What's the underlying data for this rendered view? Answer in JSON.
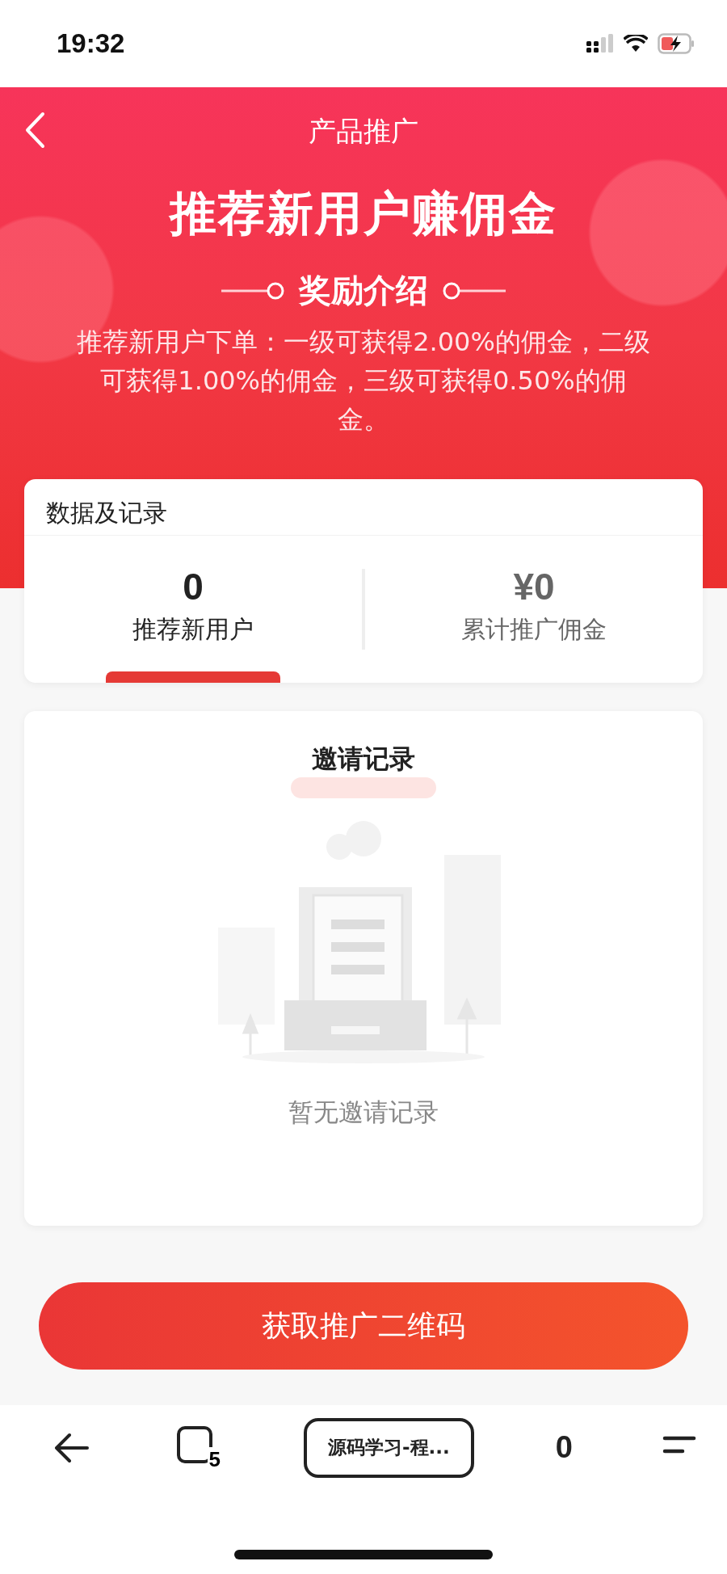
{
  "status_bar": {
    "time": "19:32"
  },
  "header": {
    "title": "产品推广",
    "headline": "推荐新用户赚佣金",
    "section_title": "奖励介绍",
    "description": "推荐新用户下单：一级可获得2.00%的佣金，二级可获得1.00%的佣金，三级可获得0.50%的佣金。"
  },
  "data_card": {
    "title": "数据及记录",
    "stats": [
      {
        "value": "0",
        "label": "推荐新用户",
        "selected": true
      },
      {
        "value": "¥0",
        "label": "累计推广佣金",
        "selected": false
      }
    ]
  },
  "invite_card": {
    "title": "邀请记录",
    "empty_text": "暂无邀请记录"
  },
  "action_button": "获取推广二维码",
  "browser_bar": {
    "tab_count": "5",
    "page_title": "源码学习-程...",
    "counter": "0"
  }
}
